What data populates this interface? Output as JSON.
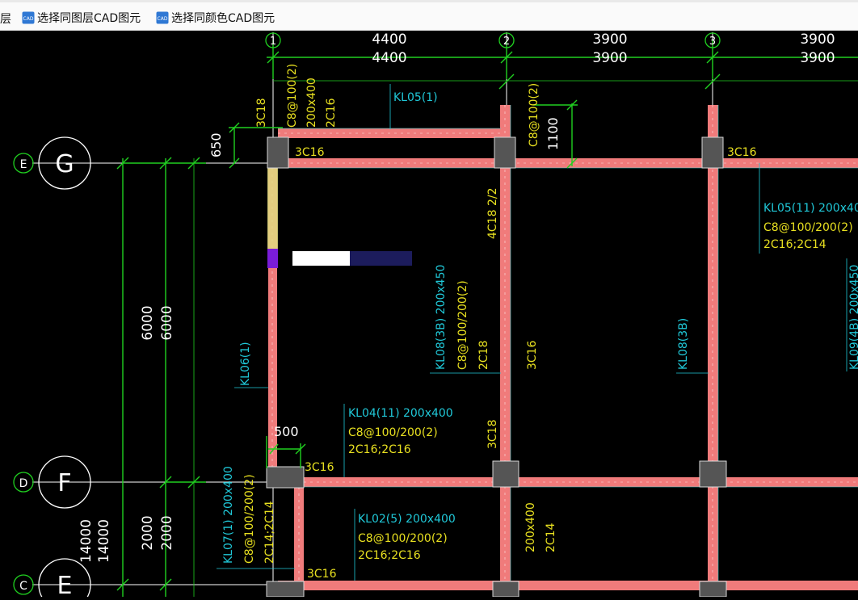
{
  "toolbar": {
    "left_fragment": "层",
    "select_same_layer_label": "选择同图层CAD图元",
    "select_same_color_label": "选择同颜色CAD图元",
    "select_same_layer_icon": "cad-layer-icon",
    "select_same_color_icon": "cad-color-icon"
  },
  "axes": {
    "top": [
      {
        "id": "1"
      },
      {
        "id": "2"
      },
      {
        "id": "3"
      }
    ],
    "top_spans": [
      "4400",
      "4400",
      "3900",
      "3900",
      "3900",
      "3900"
    ],
    "left": [
      {
        "small": "E",
        "big": "G"
      },
      {
        "small": "D",
        "big": "F"
      },
      {
        "small": "C",
        "big": "E"
      }
    ],
    "left_dims": [
      "6000",
      "6000",
      "2000",
      "2000",
      "14000",
      "14000"
    ]
  },
  "annotations": {
    "t_3c18_top": "3C18",
    "t_c8_100_2": "C8@100(2)",
    "t_200x400_a": "200x400",
    "t_2c16_a": "2C16",
    "t_kl05_1": "KL05(1)",
    "t_650": "650",
    "t_3c16_a": "3C16",
    "t_c8_100_2_b": "C8@100(2)",
    "t_1100": "1100",
    "t_3c16_b": "3C16",
    "t_kl05_11": "KL05(11) 200x40",
    "t_c8_100200_2_a": "C8@100/200(2)",
    "t_2c16_2c14_a": "2C16;2C14",
    "t_4c18_22": "4C18 2/2",
    "t_kl08_3b_200x450": "KL08(3B) 200x450",
    "t_c8_100200_2_b": "C8@100/200(2)",
    "t_2c18": "2C18",
    "t_3c16_c": "3C16",
    "t_kl08_3b": "KL08(3B)",
    "t_kl09_4b": "KL09(4B) 200x450",
    "t_kl06_1": "KL06(1)",
    "t_kl04_11": "KL04(11) 200x400",
    "t_c8_100200_2_c": "C8@100/200(2)",
    "t_2c16_2c16_a": "2C16;2C16",
    "t_500": "500",
    "t_3c18_mid": "3C18",
    "t_3c16_d": "3C16",
    "t_kl07_1": "KL07(1) 200x400",
    "t_c8_100200_2_d": "C8@100/200(2)",
    "t_2c14_2c14": "2C14;2C14",
    "t_kl02_5": "KL02(5) 200x400",
    "t_c8_100200_2_e": "C8@100/200(2)",
    "t_2c16_2c16_b": "2C16;2C16",
    "t_200x400_b": "200x400",
    "t_2c14": "2C14",
    "t_3c16_e": "3C16"
  },
  "colors": {
    "beam": "#f07b7b",
    "column": "#555555",
    "dimension": "#20d020",
    "cyan_text": "#20c8d8",
    "yellow_text": "#e8e020",
    "axis_line": "#ffffff"
  }
}
